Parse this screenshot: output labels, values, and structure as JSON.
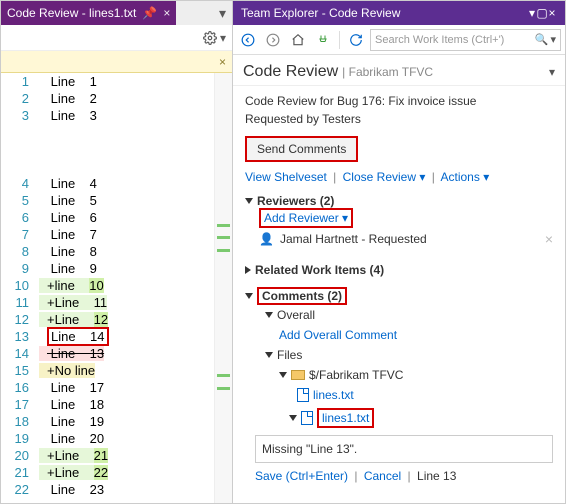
{
  "left": {
    "tab_title": "Code Review - lines1.txt",
    "lines": [
      {
        "n": "1",
        "text": " Line    1"
      },
      {
        "n": "2",
        "text": " Line    2"
      },
      {
        "n": "3",
        "text": " Line    3"
      },
      {
        "n": "",
        "text": ""
      },
      {
        "n": "",
        "text": ""
      },
      {
        "n": "",
        "text": ""
      },
      {
        "n": "4",
        "text": " Line    4"
      },
      {
        "n": "5",
        "text": " Line    5"
      },
      {
        "n": "6",
        "text": " Line    6"
      },
      {
        "n": "7",
        "text": " Line    7"
      },
      {
        "n": "8",
        "text": " Line    8"
      },
      {
        "n": "9",
        "text": " Line    9"
      },
      {
        "n": "10",
        "text": "+line    10",
        "add": true,
        "hl": "10"
      },
      {
        "n": "11",
        "text": "+Line    11",
        "add": true
      },
      {
        "n": "12",
        "text": "+Line    12",
        "add": true,
        "hl": "12"
      },
      {
        "n": "13",
        "text": " Line    14",
        "box": true
      },
      {
        "n": "14",
        "text": " Line    13",
        "del": true
      },
      {
        "n": "15",
        "text": "+No line",
        "add": true,
        "sel": true
      },
      {
        "n": "16",
        "text": " Line    17"
      },
      {
        "n": "17",
        "text": " Line    18"
      },
      {
        "n": "18",
        "text": " Line    19"
      },
      {
        "n": "19",
        "text": " Line    20"
      },
      {
        "n": "20",
        "text": "+Line    21",
        "add": true,
        "hl": "21"
      },
      {
        "n": "21",
        "text": "+Line    22",
        "add": true,
        "hl": "22"
      },
      {
        "n": "22",
        "text": " Line    23"
      }
    ]
  },
  "right": {
    "title": "Team Explorer - Code Review",
    "search_placeholder": "Search Work Items (Ctrl+')",
    "header": "Code Review",
    "header_sub": "Fabrikam TFVC",
    "summary": "Code Review for Bug 176: Fix invoice issue",
    "requested_by": "Requested by Testers",
    "send_btn": "Send Comments",
    "view_shelveset": "View Shelveset",
    "close_review": "Close Review",
    "actions": "Actions",
    "reviewers_h": "Reviewers (2)",
    "add_reviewer": "Add Reviewer",
    "reviewer_name": "Jamal Hartnett - Requested",
    "related_h": "Related Work Items (4)",
    "comments_h": "Comments (2)",
    "overall": "Overall",
    "add_overall": "Add Overall Comment",
    "files": "Files",
    "folder": "$/Fabrikam TFVC",
    "file1": "lines.txt",
    "file2": "lines1.txt",
    "comment_text": "Missing \"Line 13\".",
    "save": "Save (Ctrl+Enter)",
    "cancel": "Cancel",
    "status": "Line 13"
  }
}
